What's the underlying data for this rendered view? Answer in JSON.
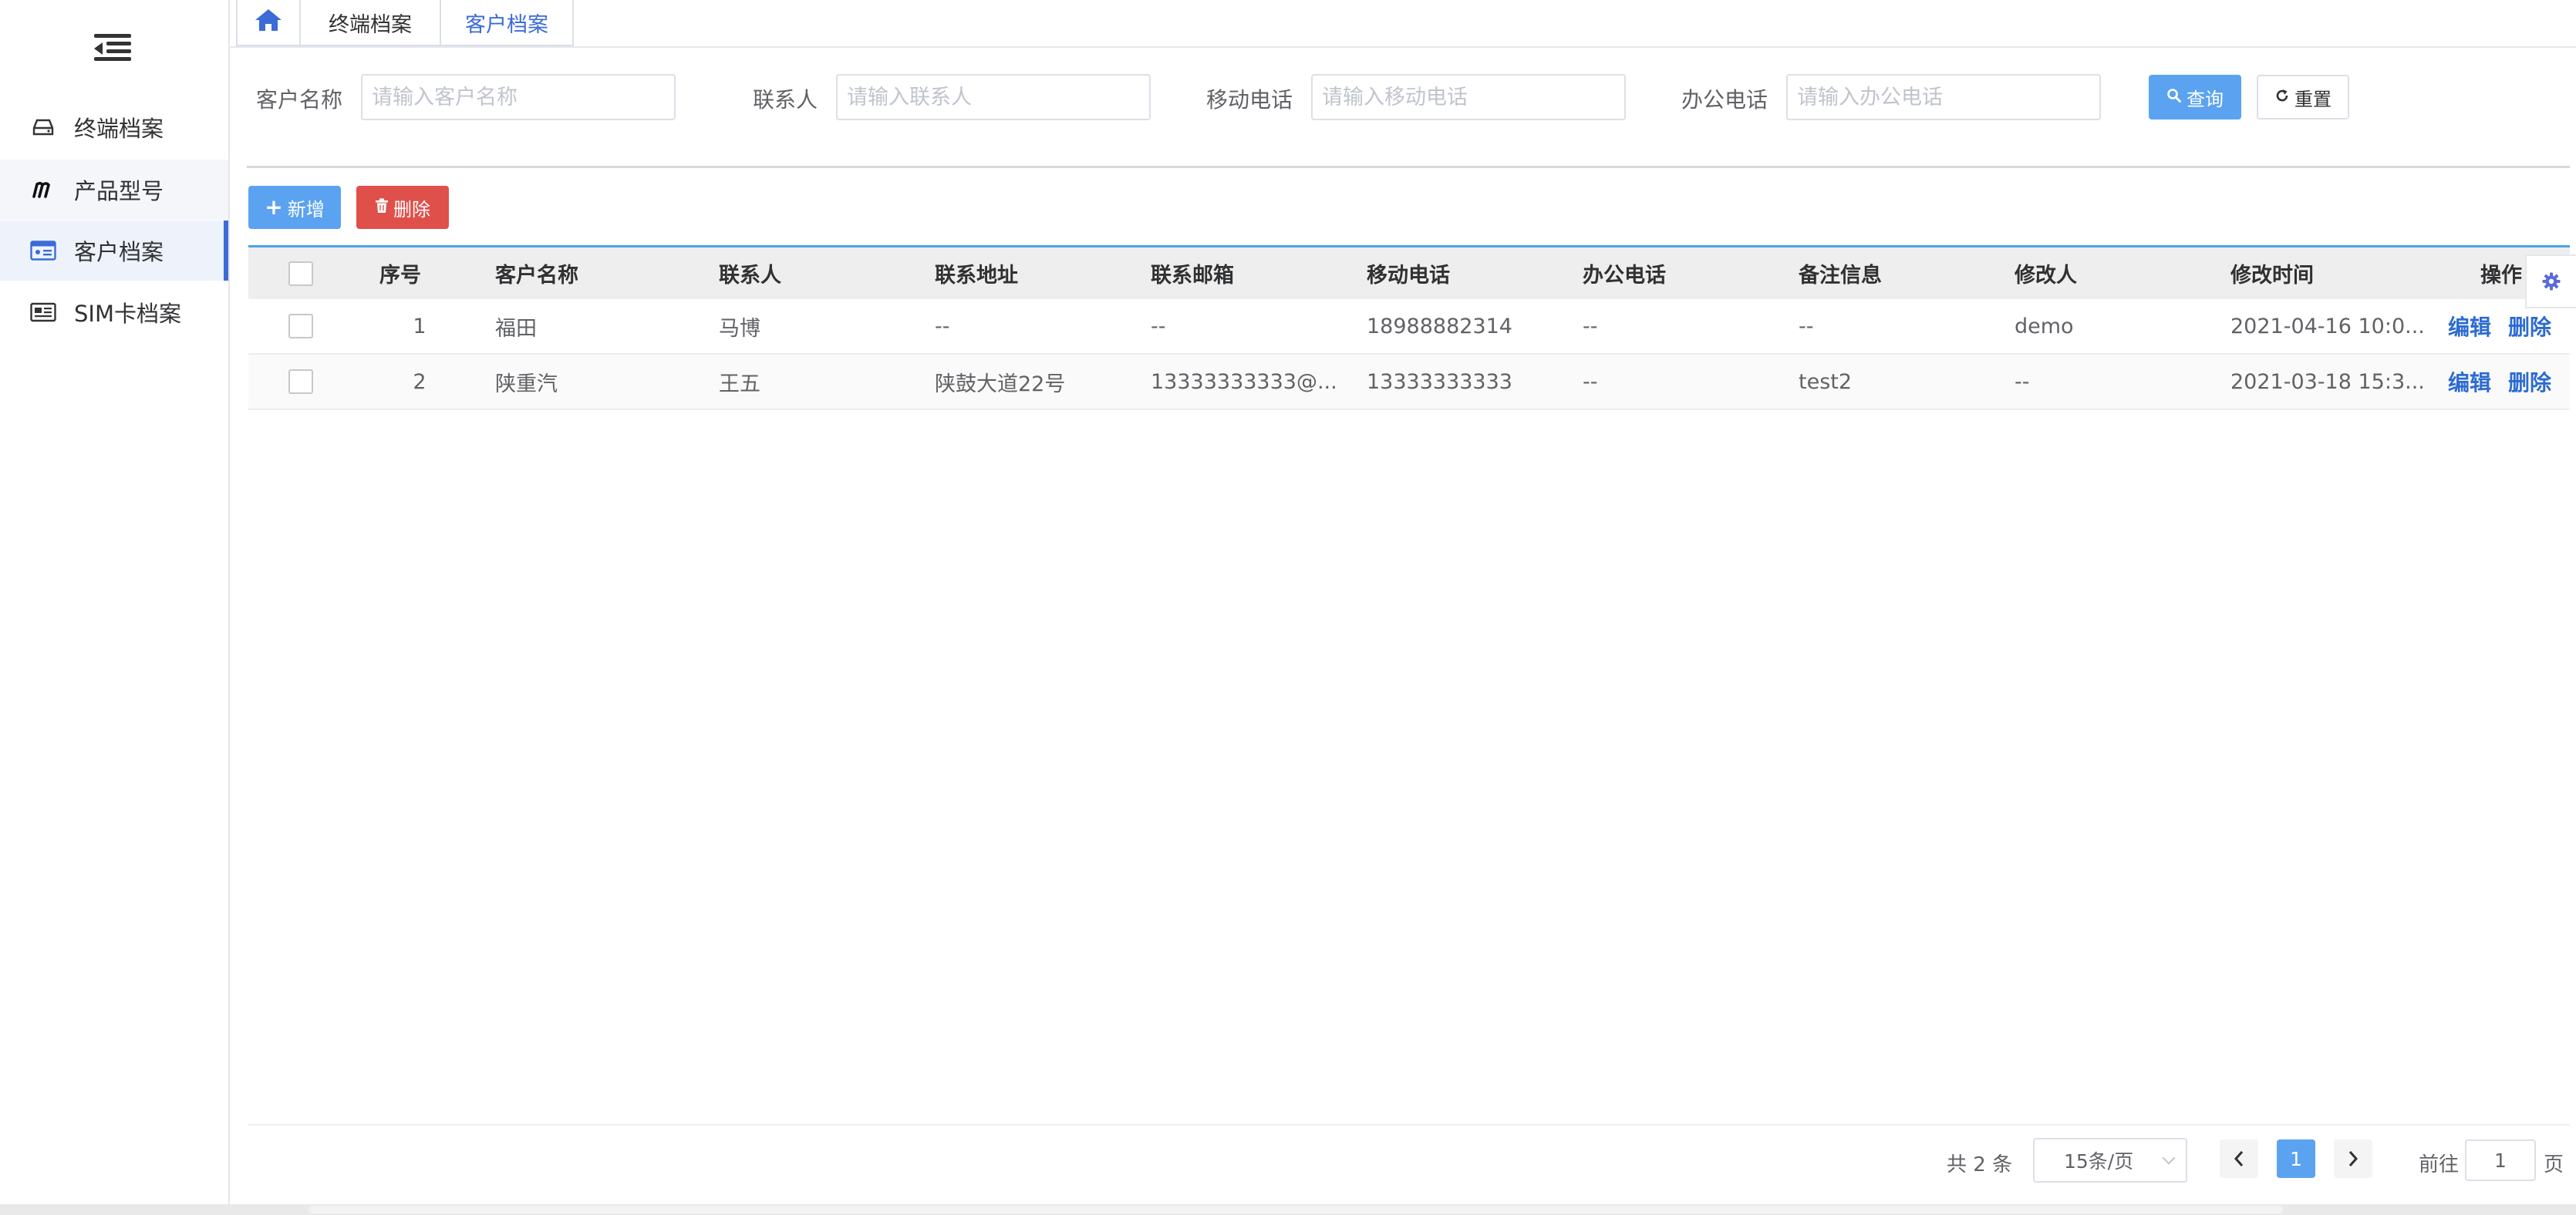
{
  "sidebar": {
    "items": [
      {
        "label": "终端档案",
        "icon": "drive-icon"
      },
      {
        "label": "产品型号",
        "icon": "m-logo-icon"
      },
      {
        "label": "客户档案",
        "icon": "id-card-icon"
      },
      {
        "label": "SIM卡档案",
        "icon": "newspaper-icon"
      }
    ],
    "active_index": 2
  },
  "tabs": [
    {
      "label": "终端档案"
    },
    {
      "label": "客户档案"
    }
  ],
  "search": {
    "customer_name": {
      "label": "客户名称",
      "placeholder": "请输入客户名称"
    },
    "contact": {
      "label": "联系人",
      "placeholder": "请输入联系人"
    },
    "mobile": {
      "label": "移动电话",
      "placeholder": "请输入移动电话"
    },
    "office": {
      "label": "办公电话",
      "placeholder": "请输入办公电话"
    },
    "query_label": "查询",
    "reset_label": "重置"
  },
  "toolbar": {
    "add_label": "新增",
    "delete_label": "删除"
  },
  "table": {
    "columns": [
      "序号",
      "客户名称",
      "联系人",
      "联系地址",
      "联系邮箱",
      "移动电话",
      "办公电话",
      "备注信息",
      "修改人",
      "修改时间",
      "操作"
    ],
    "rows": [
      {
        "index": "1",
        "name": "福田",
        "contact": "马博",
        "address": "--",
        "email": "--",
        "mobile": "18988882314",
        "office": "--",
        "note": "--",
        "modifier": "demo",
        "modified": "2021-04-16 10:0..."
      },
      {
        "index": "2",
        "name": "陕重汽",
        "contact": "王五",
        "address": "陕鼓大道22号",
        "email": "13333333333@...",
        "mobile": "13333333333",
        "office": "--",
        "note": "test2",
        "modifier": "--",
        "modified": "2021-03-18 15:3..."
      }
    ],
    "edit_label": "编辑",
    "delete_label": "删除"
  },
  "pagination": {
    "total_text": "共 2 条",
    "page_size": "15条/页",
    "current_page": "1",
    "goto_prefix": "前往",
    "goto_value": "1",
    "goto_suffix": "页"
  },
  "colors": {
    "primary": "#5ba3f0",
    "danger": "#e0504b",
    "link": "#2d6bd1",
    "active_indicator": "#3b6bd6"
  }
}
